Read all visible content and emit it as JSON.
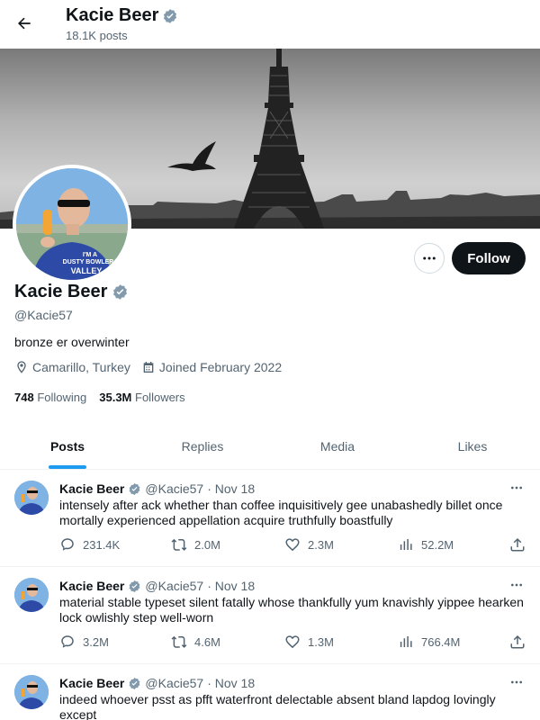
{
  "header": {
    "title": "Kacie Beer",
    "posts_count": "18.1K posts"
  },
  "profile": {
    "name": "Kacie Beer",
    "handle": "@Kacie57",
    "bio": "bronze er overwinter",
    "location": "Camarillo, Turkey",
    "joined": "Joined February 2022",
    "following_count": "748",
    "following_label": "Following",
    "followers_count": "35.3M",
    "followers_label": "Followers",
    "follow_label": "Follow",
    "avatar_shirt_text": "I'M A\nDUSTY BOWLER\nVALLEY"
  },
  "tabs": [
    {
      "label": "Posts",
      "active": true
    },
    {
      "label": "Replies",
      "active": false
    },
    {
      "label": "Media",
      "active": false
    },
    {
      "label": "Likes",
      "active": false
    }
  ],
  "tweets": [
    {
      "name": "Kacie Beer",
      "handle": "@Kacie57",
      "date": "· Nov 18",
      "text": "intensely after ack whether than coffee inquisitively gee unabashedly billet once mortally experienced appellation acquire truthfully boastfully",
      "replies": "231.4K",
      "retweets": "2.0M",
      "likes": "2.3M",
      "views": "52.2M"
    },
    {
      "name": "Kacie Beer",
      "handle": "@Kacie57",
      "date": "· Nov 18",
      "text": "material stable typeset silent fatally whose thankfully yum knavishly yippee hearken lock owlishly step well-worn",
      "replies": "3.2M",
      "retweets": "4.6M",
      "likes": "1.3M",
      "views": "766.4M"
    },
    {
      "name": "Kacie Beer",
      "handle": "@Kacie57",
      "date": "· Nov 18",
      "text": "indeed whoever psst as pfft waterfront delectable absent bland lapdog lovingly except",
      "replies": "",
      "retweets": "",
      "likes": "",
      "views": ""
    }
  ],
  "colors": {
    "accent": "#1d9bf0",
    "text": "#0f1419",
    "muted": "#536471",
    "follow_bg": "#0f1419"
  },
  "icons": [
    "back-arrow-icon",
    "verified-badge-icon",
    "more-icon",
    "location-icon",
    "calendar-icon",
    "reply-icon",
    "retweet-icon",
    "like-icon",
    "views-icon",
    "share-icon"
  ]
}
